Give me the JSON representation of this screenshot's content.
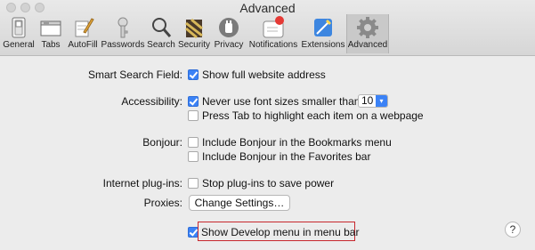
{
  "window": {
    "title": "Advanced"
  },
  "toolbar": [
    {
      "label": "General",
      "icon": "general-switch-icon"
    },
    {
      "label": "Tabs",
      "icon": "tabs-icon"
    },
    {
      "label": "AutoFill",
      "icon": "pencil-icon"
    },
    {
      "label": "Passwords",
      "icon": "key-icon"
    },
    {
      "label": "Search",
      "icon": "magnifier-icon"
    },
    {
      "label": "Security",
      "icon": "padlock-icon"
    },
    {
      "label": "Privacy",
      "icon": "hand-icon"
    },
    {
      "label": "Notifications",
      "icon": "notifications-icon"
    },
    {
      "label": "Extensions",
      "icon": "extensions-icon"
    },
    {
      "label": "Advanced",
      "icon": "gear-icon",
      "selected": true
    }
  ],
  "settings": {
    "smart_search": {
      "label": "Smart Search Field:",
      "option": "Show full website address",
      "checked": true
    },
    "accessibility": {
      "label": "Accessibility:",
      "option1": "Never use font sizes smaller than",
      "option1_checked": true,
      "font_size": "10",
      "option2": "Press Tab to highlight each item on a webpage",
      "option2_checked": false
    },
    "bonjour": {
      "label": "Bonjour:",
      "option1": "Include Bonjour in the Bookmarks menu",
      "option2": "Include Bonjour in the Favorites bar"
    },
    "plugins": {
      "label": "Internet plug-ins:",
      "option": "Stop plug-ins to save power"
    },
    "proxies": {
      "label": "Proxies:",
      "button": "Change Settings…"
    },
    "develop": {
      "option": "Show Develop menu in menu bar",
      "checked": true
    }
  },
  "help": {
    "label": "?"
  },
  "colors": {
    "accent": "#3b82f6",
    "highlight_border": "#c7272d"
  }
}
